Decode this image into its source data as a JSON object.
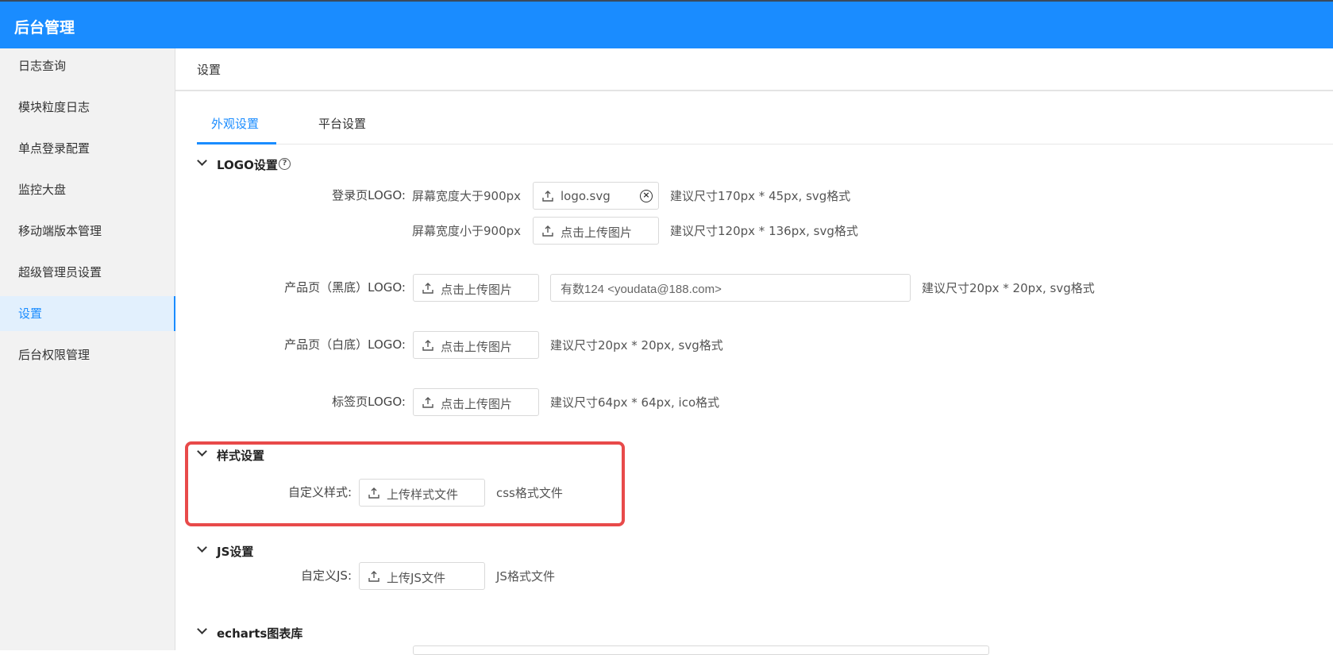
{
  "app": {
    "title": "后台管理"
  },
  "sidebar": {
    "items": [
      {
        "label": "日志查询"
      },
      {
        "label": "模块粒度日志"
      },
      {
        "label": "单点登录配置"
      },
      {
        "label": "监控大盘"
      },
      {
        "label": "移动端版本管理"
      },
      {
        "label": "超级管理员设置"
      },
      {
        "label": "设置",
        "active": true
      },
      {
        "label": "后台权限管理"
      }
    ]
  },
  "page": {
    "title": "设置"
  },
  "tabs": [
    {
      "label": "外观设置",
      "active": true
    },
    {
      "label": "平台设置"
    }
  ],
  "logo_section": {
    "title": "LOGO设置",
    "help_icon": "question-circle-icon",
    "login_logo": {
      "label": "登录页LOGO:",
      "wide": {
        "sublabel": "屏幕宽度大于900px",
        "file": "logo.svg",
        "hint": "建议尺寸170px * 45px, svg格式"
      },
      "narrow": {
        "sublabel": "屏幕宽度小于900px",
        "button": "点击上传图片",
        "hint": "建议尺寸120px * 136px, svg格式"
      }
    },
    "product_dark": {
      "label": "产品页（黑底）LOGO:",
      "button": "点击上传图片",
      "input_value": "有数124 <youdata@188.com>",
      "hint": "建议尺寸20px * 20px, svg格式"
    },
    "product_light": {
      "label": "产品页（白底）LOGO:",
      "button": "点击上传图片",
      "hint": "建议尺寸20px * 20px, svg格式"
    },
    "tab_logo": {
      "label": "标签页LOGO:",
      "button": "点击上传图片",
      "hint": "建议尺寸64px * 64px, ico格式"
    }
  },
  "style_section": {
    "title": "样式设置",
    "custom_style": {
      "label": "自定义样式:",
      "button": "上传样式文件",
      "hint": "css格式文件"
    }
  },
  "js_section": {
    "title": "JS设置",
    "custom_js": {
      "label": "自定义JS:",
      "button": "上传JS文件",
      "hint": "JS格式文件"
    }
  },
  "echarts_section": {
    "title": "echarts图表库"
  },
  "colors": {
    "primary": "#1a8cff",
    "highlight": "#e84a4a",
    "sidebar_bg": "#f2f2f2"
  }
}
